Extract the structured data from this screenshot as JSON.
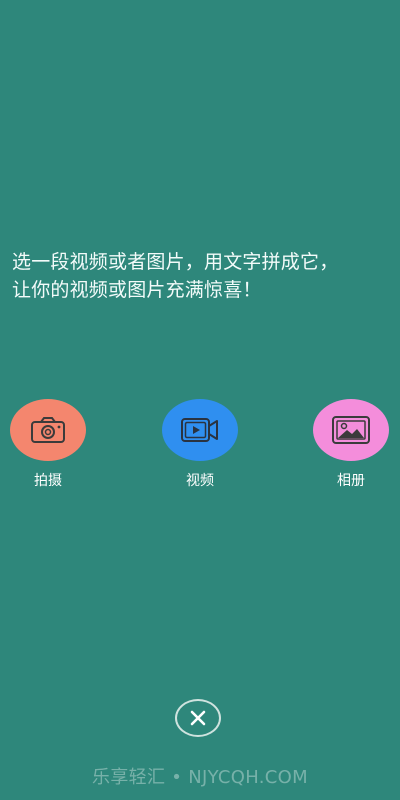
{
  "intro": {
    "line1": "选一段视频或者图片，用文字拼成它，",
    "line2": "让你的视频或图片充满惊喜！"
  },
  "options": [
    {
      "label": "拍摄",
      "icon": "camera-icon",
      "color": "#f4866e"
    },
    {
      "label": "视频",
      "icon": "video-icon",
      "color": "#2f8ff0"
    },
    {
      "label": "相册",
      "icon": "image-icon",
      "color": "#f48ddb"
    }
  ],
  "close": {
    "icon": "close-icon"
  },
  "watermark": "乐享轻汇 • NJYCQH.COM",
  "colors": {
    "background": "#2e877b",
    "icon_stroke": "#3b3b3b"
  }
}
